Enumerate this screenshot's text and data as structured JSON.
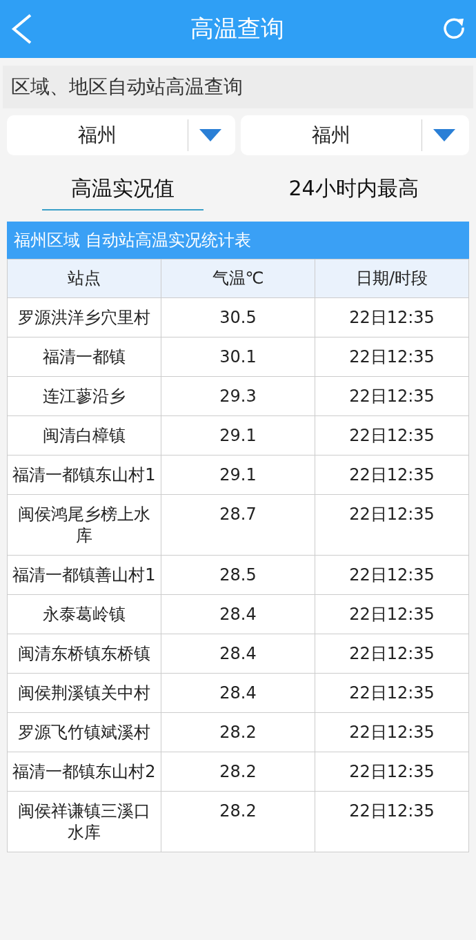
{
  "header": {
    "title": "高温查询"
  },
  "section_title": "区域、地区自动站高温查询",
  "dropdowns": [
    {
      "value": "福州"
    },
    {
      "value": "福州"
    }
  ],
  "tabs": [
    {
      "label": "高温实况值",
      "selected": true
    },
    {
      "label": "24小时内最高",
      "selected": false
    }
  ],
  "table": {
    "title": "福州区域 自动站高温实况统计表",
    "columns": [
      "站点",
      "气温℃",
      "日期/时段"
    ],
    "rows": [
      [
        "罗源洪洋乡穴里村",
        "30.5",
        "22日12:35"
      ],
      [
        "福清一都镇",
        "30.1",
        "22日12:35"
      ],
      [
        "连江蓼沿乡",
        "29.3",
        "22日12:35"
      ],
      [
        "闽清白樟镇",
        "29.1",
        "22日12:35"
      ],
      [
        "福清一都镇东山村1",
        "29.1",
        "22日12:35"
      ],
      [
        "闽侯鸿尾乡榜上水库",
        "28.7",
        "22日12:35"
      ],
      [
        "福清一都镇善山村1",
        "28.5",
        "22日12:35"
      ],
      [
        "永泰葛岭镇",
        "28.4",
        "22日12:35"
      ],
      [
        "闽清东桥镇东桥镇",
        "28.4",
        "22日12:35"
      ],
      [
        "闽侯荆溪镇关中村",
        "28.4",
        "22日12:35"
      ],
      [
        "罗源飞竹镇斌溪村",
        "28.2",
        "22日12:35"
      ],
      [
        "福清一都镇东山村2",
        "28.2",
        "22日12:35"
      ],
      [
        "闽侯祥谦镇三溪口水库",
        "28.2",
        "22日12:35"
      ]
    ]
  }
}
